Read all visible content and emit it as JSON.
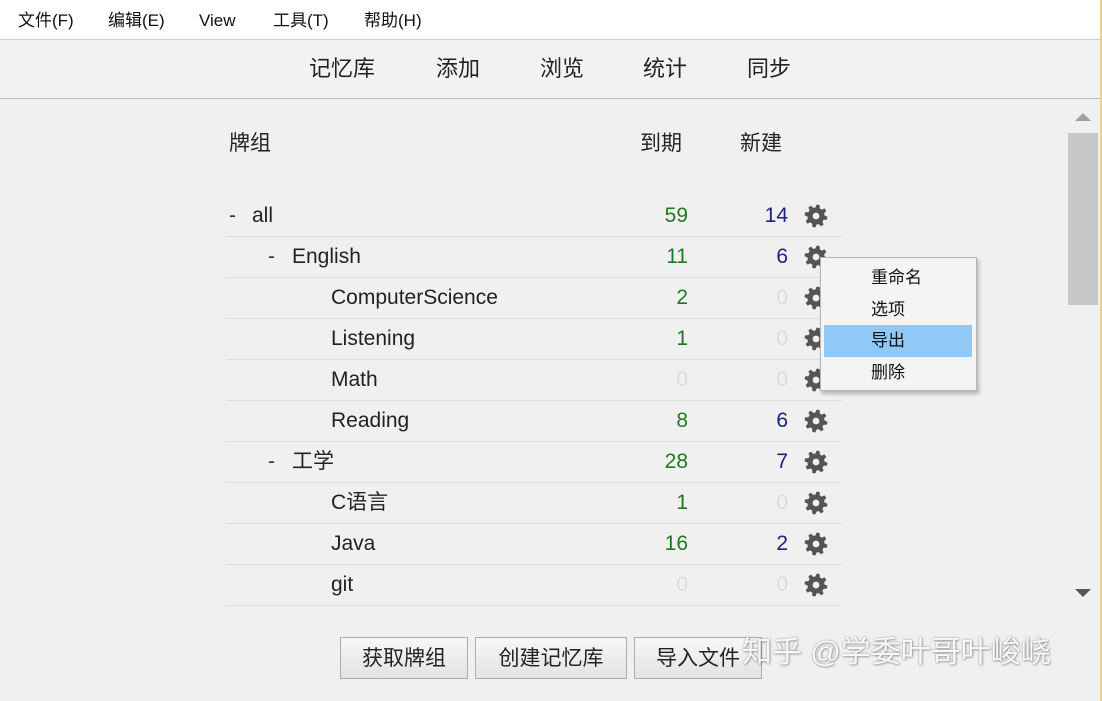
{
  "menubar": {
    "items": [
      "文件(F)",
      "编辑(E)",
      "View",
      "工具(T)",
      "帮助(H)"
    ]
  },
  "toolbar": {
    "items": [
      "记忆库",
      "添加",
      "浏览",
      "统计",
      "同步"
    ]
  },
  "deck_list": {
    "headers": {
      "deck": "牌组",
      "due": "到期",
      "new": "新建"
    },
    "rows": [
      {
        "collapse": "-",
        "name": "all",
        "due": "59",
        "new": "14",
        "due_zero": false,
        "new_zero": false
      },
      {
        "collapse": "-",
        "name": "English",
        "due": "11",
        "new": "6",
        "due_zero": false,
        "new_zero": false
      },
      {
        "collapse": "",
        "name": "ComputerScience",
        "due": "2",
        "new": "0",
        "due_zero": false,
        "new_zero": true
      },
      {
        "collapse": "",
        "name": "Listening",
        "due": "1",
        "new": "0",
        "due_zero": false,
        "new_zero": true
      },
      {
        "collapse": "",
        "name": "Math",
        "due": "0",
        "new": "0",
        "due_zero": true,
        "new_zero": true
      },
      {
        "collapse": "",
        "name": "Reading",
        "due": "8",
        "new": "6",
        "due_zero": false,
        "new_zero": false
      },
      {
        "collapse": "-",
        "name": "工学",
        "due": "28",
        "new": "7",
        "due_zero": false,
        "new_zero": false
      },
      {
        "collapse": "",
        "name": "C语言",
        "due": "1",
        "new": "0",
        "due_zero": false,
        "new_zero": true
      },
      {
        "collapse": "",
        "name": "Java",
        "due": "16",
        "new": "2",
        "due_zero": false,
        "new_zero": false
      },
      {
        "collapse": "",
        "name": "git",
        "due": "0",
        "new": "0",
        "due_zero": true,
        "new_zero": true
      }
    ]
  },
  "context_menu": {
    "items": [
      "重命名",
      "选项",
      "导出",
      "删除"
    ],
    "active_item": "导出"
  },
  "bottom_buttons": [
    "获取牌组",
    "创建记忆库",
    "导入文件"
  ],
  "watermark": "知乎 @学委叶哥叶峻峣",
  "colors": {
    "due": "#1f7a1f",
    "new": "#1a237e",
    "zero": "#dcdcdc",
    "menu_highlight": "#90c8f6"
  }
}
